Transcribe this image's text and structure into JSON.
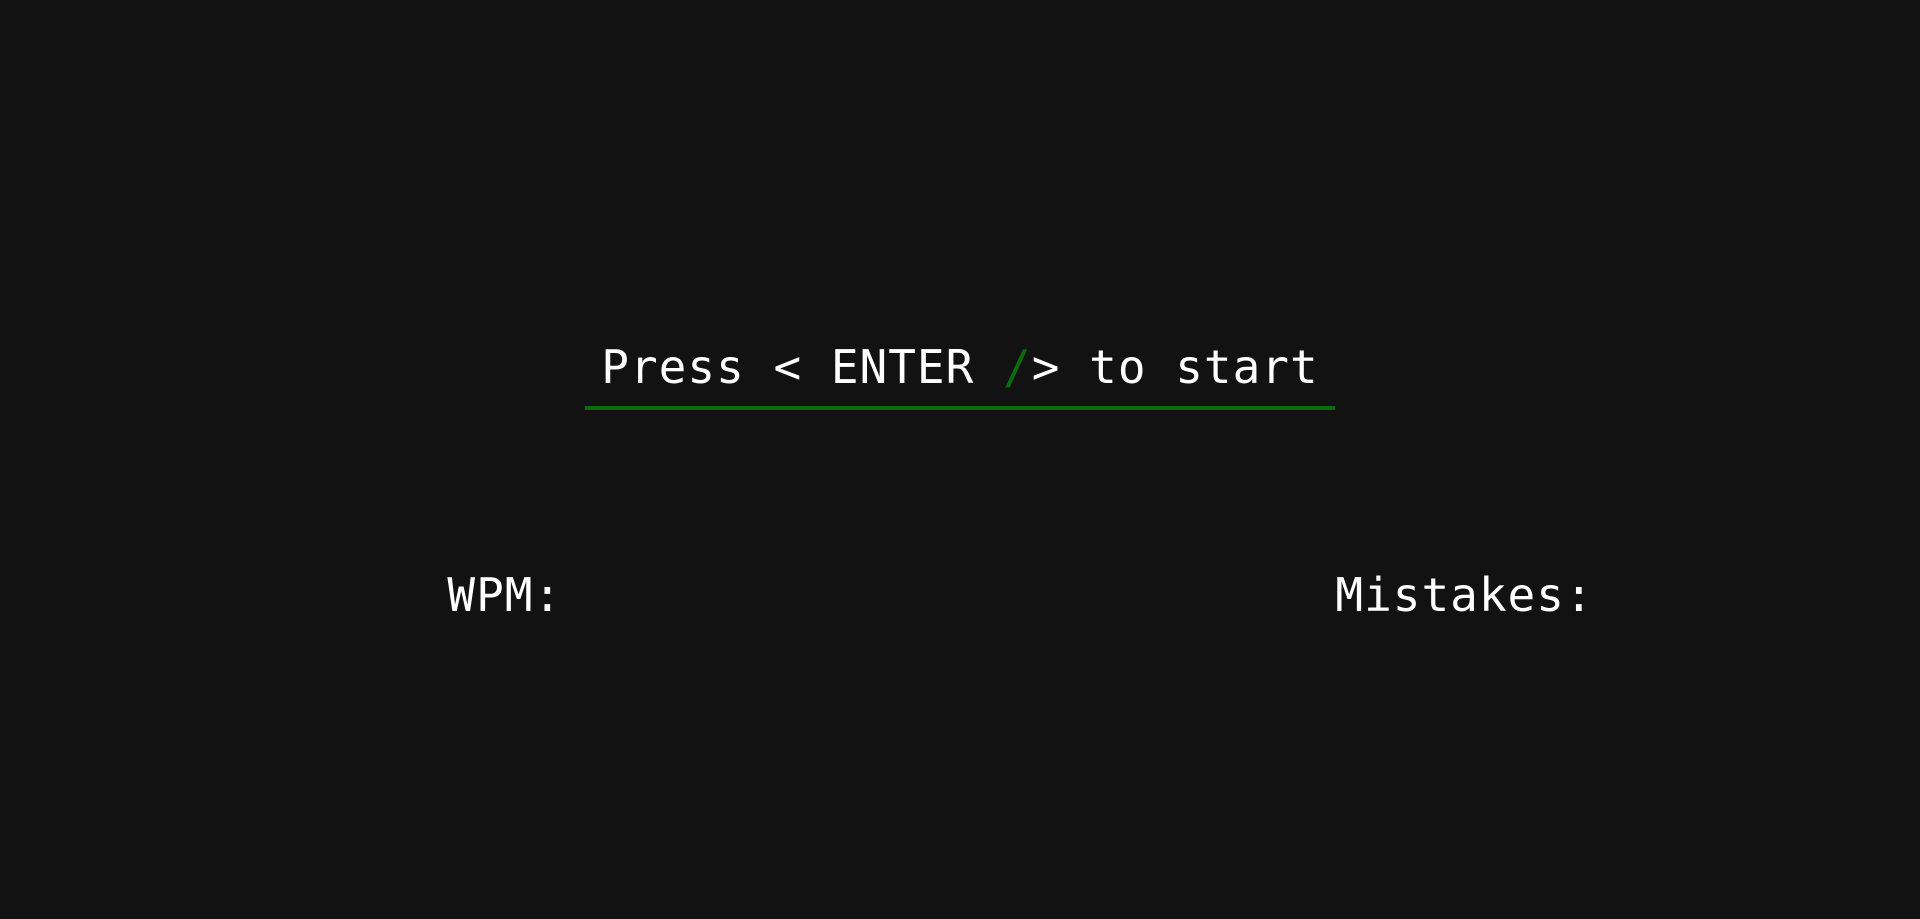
{
  "prompt": {
    "before": "Press < ENTER ",
    "slash": "/",
    "after": "> to start"
  },
  "stats": {
    "wpm_label": "WPM:",
    "wpm_value": "",
    "mistakes_label": "Mistakes:",
    "mistakes_value": ""
  },
  "colors": {
    "background": "#121212",
    "text": "#ffffff",
    "accent": "#0b6b0b"
  }
}
